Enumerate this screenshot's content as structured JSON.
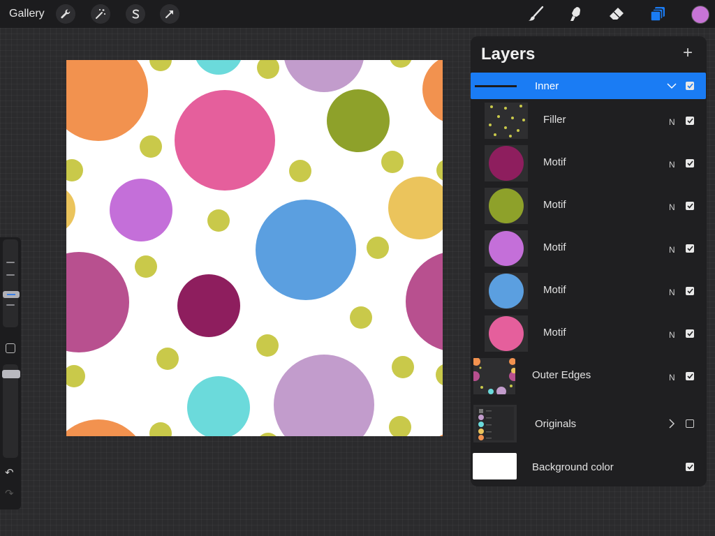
{
  "toolbar": {
    "gallery_label": "Gallery",
    "action_icons": [
      "wrench-icon",
      "magic-wand-icon",
      "selection-s-icon",
      "transform-arrow-icon"
    ],
    "tool_icons": [
      "brush-icon",
      "smudge-icon",
      "eraser-icon",
      "layers-icon"
    ],
    "current_color": "#c774d6",
    "layers_icon_color": "#1a7cf4"
  },
  "layers_panel": {
    "title": "Layers",
    "add_icon": "plus-icon",
    "rows": [
      {
        "name": "Inner",
        "mode": "",
        "checked": true,
        "group": true,
        "expanded": true,
        "active": true
      },
      {
        "name": "Filler",
        "mode": "N",
        "checked": true
      },
      {
        "name": "Motif",
        "mode": "N",
        "checked": true,
        "thumb_color": "#8e1e5e"
      },
      {
        "name": "Motif",
        "mode": "N",
        "checked": true,
        "thumb_color": "#8ea12a"
      },
      {
        "name": "Motif",
        "mode": "N",
        "checked": true,
        "thumb_color": "#c46fd9"
      },
      {
        "name": "Motif",
        "mode": "N",
        "checked": true,
        "thumb_color": "#5b9fe0"
      },
      {
        "name": "Motif",
        "mode": "N",
        "checked": true,
        "thumb_color": "#e55f9c"
      },
      {
        "name": "Outer Edges",
        "mode": "N",
        "checked": true
      },
      {
        "name": "Originals",
        "mode": "",
        "checked": false,
        "group": true,
        "expanded": false
      },
      {
        "name": "Background color",
        "mode": "",
        "checked": true
      }
    ]
  },
  "palette": {
    "orange": "#f2924f",
    "pink": "#e55f9c",
    "olive": "#8ea12a",
    "yellow_green": "#c9c94a",
    "purple": "#c46fd9",
    "blue": "#5b9fe0",
    "magenta": "#b8508f",
    "maroon": "#8e1e5e",
    "yellow": "#ebc45c",
    "cyan": "#6bdadb",
    "lavender": "#c29ccc"
  }
}
